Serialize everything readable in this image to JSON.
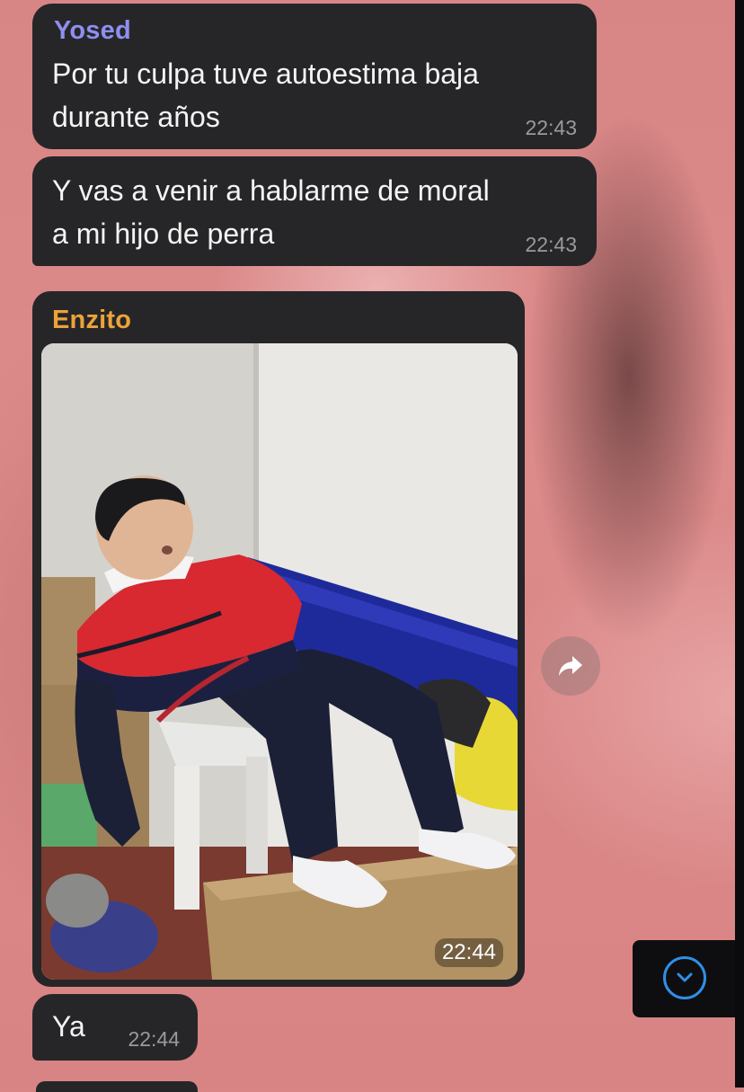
{
  "chat": {
    "messages": [
      {
        "sender": "Yosed",
        "sender_color": "#8f8ef0",
        "lines": [
          "Por tu culpa tuve autoestima baja",
          "durante años"
        ],
        "time": "22:43"
      },
      {
        "lines": [
          "Y vas a venir a hablarme de moral",
          "a mi hijo de perra"
        ],
        "time": "22:43"
      },
      {
        "sender": "Enzito",
        "sender_color": "#eba33a",
        "media": "photo",
        "time": "22:44"
      },
      {
        "text": "Ya",
        "time": "22:44"
      }
    ]
  },
  "controls": {
    "forward_icon": "share-arrow-icon",
    "scroll_down_icon": "chevron-down-icon",
    "accent_color": "#2f8fe8"
  }
}
